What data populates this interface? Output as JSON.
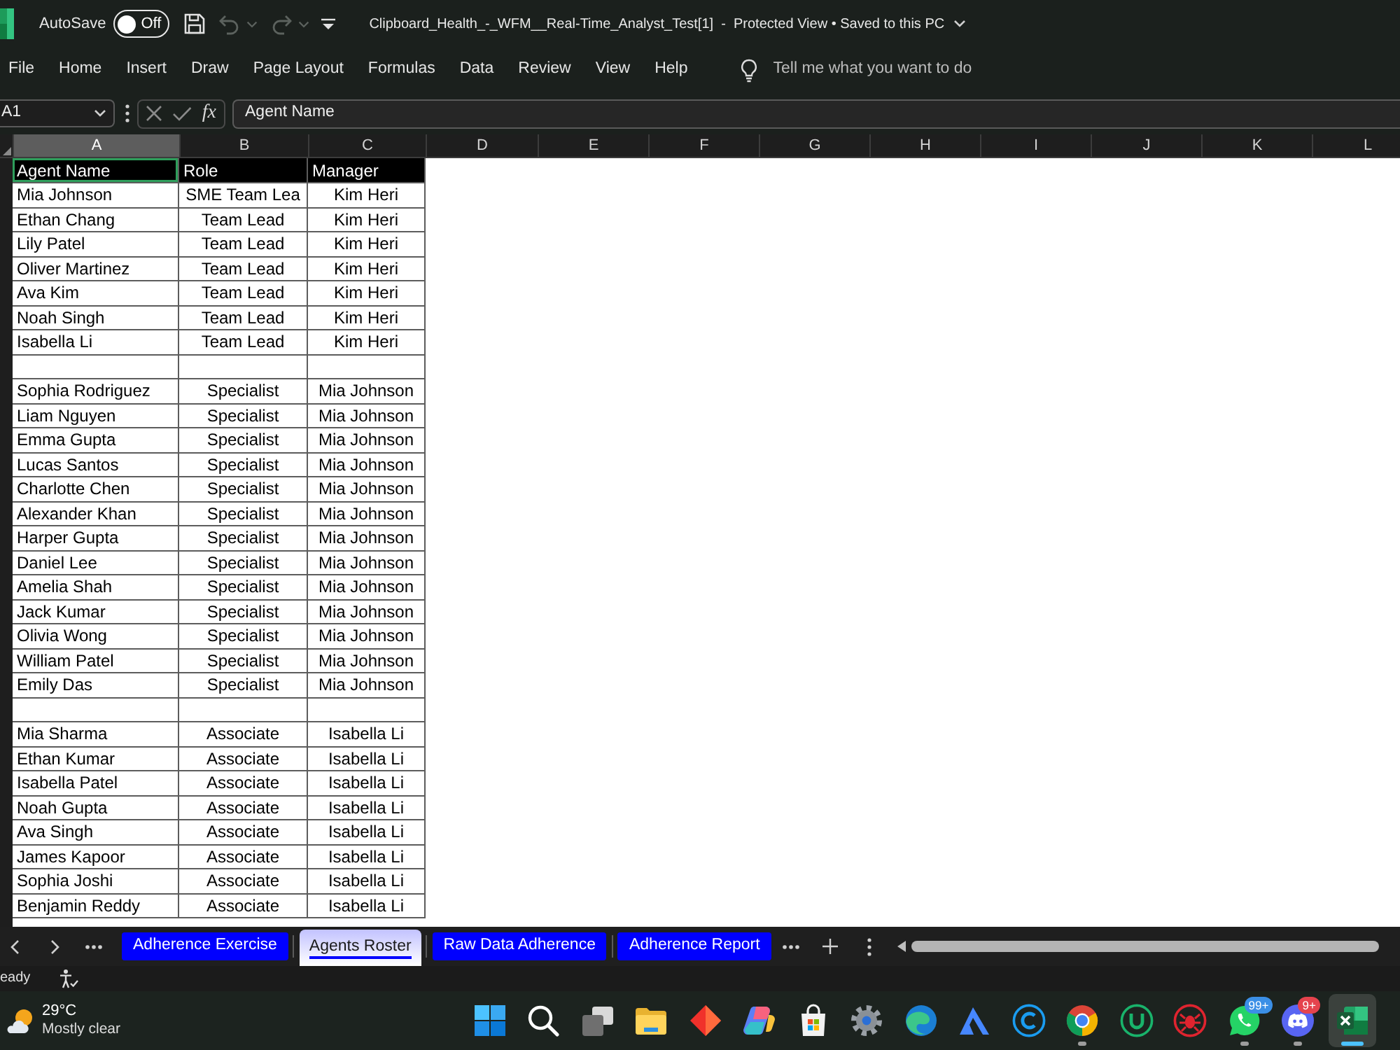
{
  "title_bar": {
    "autosave_label": "AutoSave",
    "autosave": {
      "on": false,
      "label": "Off"
    },
    "quick_access": [
      {
        "kind": "save",
        "disabled": false
      },
      {
        "kind": "undo",
        "disabled": true
      },
      {
        "kind": "redo",
        "disabled": true
      },
      {
        "kind": "customize",
        "disabled": false
      }
    ],
    "title": "Clipboard_Health_-_WFM__Real-Time_Analyst_Test[1]  -  Protected View • Saved to this PC"
  },
  "ribbon_tabs": [
    "File",
    "Home",
    "Insert",
    "Draw",
    "Page Layout",
    "Formulas",
    "Data",
    "Review",
    "View",
    "Help"
  ],
  "tell_me": {
    "placeholder": "Tell me what you want to do"
  },
  "formula_bar": {
    "name_box": "A1",
    "function_label": "fx",
    "value": "Agent Name"
  },
  "columns": [
    {
      "label": "A",
      "selected": true
    },
    {
      "label": "B",
      "selected": false
    },
    {
      "label": "C",
      "selected": false
    },
    {
      "label": "D",
      "selected": false
    },
    {
      "label": "E",
      "selected": false
    },
    {
      "label": "F",
      "selected": false
    },
    {
      "label": "G",
      "selected": false
    },
    {
      "label": "H",
      "selected": false
    },
    {
      "label": "I",
      "selected": false
    },
    {
      "label": "J",
      "selected": false
    },
    {
      "label": "K",
      "selected": false
    },
    {
      "label": "L",
      "selected": false
    }
  ],
  "sheet": {
    "header": [
      {
        "text": "Agent Name",
        "selected": true
      },
      {
        "text": "Role",
        "selected": false
      },
      {
        "text": "Manager",
        "selected": false
      }
    ],
    "rows": [
      {
        "kind": "data",
        "cells": [
          "Mia Johnson",
          "SME Team Lea",
          "Kim Heri"
        ]
      },
      {
        "kind": "data",
        "cells": [
          "Ethan Chang",
          "Team Lead",
          "Kim Heri"
        ]
      },
      {
        "kind": "data",
        "cells": [
          "Lily Patel",
          "Team Lead",
          "Kim Heri"
        ]
      },
      {
        "kind": "data",
        "cells": [
          "Oliver Martinez",
          "Team Lead",
          "Kim Heri"
        ]
      },
      {
        "kind": "data",
        "cells": [
          "Ava Kim",
          "Team Lead",
          "Kim Heri"
        ]
      },
      {
        "kind": "data",
        "cells": [
          "Noah Singh",
          "Team Lead",
          "Kim Heri"
        ]
      },
      {
        "kind": "data",
        "cells": [
          "Isabella Li",
          "Team Lead",
          "Kim Heri"
        ]
      },
      {
        "kind": "blank"
      },
      {
        "kind": "data",
        "cells": [
          "Sophia Rodriguez",
          "Specialist",
          "Mia Johnson"
        ]
      },
      {
        "kind": "data",
        "cells": [
          "Liam Nguyen",
          "Specialist",
          "Mia Johnson"
        ]
      },
      {
        "kind": "data",
        "cells": [
          "Emma Gupta",
          "Specialist",
          "Mia Johnson"
        ]
      },
      {
        "kind": "data",
        "cells": [
          "Lucas Santos",
          "Specialist",
          "Mia Johnson"
        ]
      },
      {
        "kind": "data",
        "cells": [
          "Charlotte Chen",
          "Specialist",
          "Mia Johnson"
        ]
      },
      {
        "kind": "data",
        "cells": [
          "Alexander Khan",
          "Specialist",
          "Mia Johnson"
        ]
      },
      {
        "kind": "data",
        "cells": [
          "Harper Gupta",
          "Specialist",
          "Mia Johnson"
        ]
      },
      {
        "kind": "data",
        "cells": [
          "Daniel Lee",
          "Specialist",
          "Mia Johnson"
        ]
      },
      {
        "kind": "data",
        "cells": [
          "Amelia Shah",
          "Specialist",
          "Mia Johnson"
        ]
      },
      {
        "kind": "data",
        "cells": [
          "Jack Kumar",
          "Specialist",
          "Mia Johnson"
        ]
      },
      {
        "kind": "data",
        "cells": [
          "Olivia Wong",
          "Specialist",
          "Mia Johnson"
        ]
      },
      {
        "kind": "data",
        "cells": [
          "William Patel",
          "Specialist",
          "Mia Johnson"
        ]
      },
      {
        "kind": "data",
        "cells": [
          "Emily Das",
          "Specialist",
          "Mia Johnson"
        ]
      },
      {
        "kind": "blank"
      },
      {
        "kind": "data",
        "cells": [
          "Mia Sharma",
          "Associate",
          "Isabella Li"
        ]
      },
      {
        "kind": "data",
        "cells": [
          "Ethan Kumar",
          "Associate",
          "Isabella Li"
        ]
      },
      {
        "kind": "data",
        "cells": [
          "Isabella Patel",
          "Associate",
          "Isabella Li"
        ]
      },
      {
        "kind": "data",
        "cells": [
          "Noah Gupta",
          "Associate",
          "Isabella Li"
        ]
      },
      {
        "kind": "data",
        "cells": [
          "Ava Singh",
          "Associate",
          "Isabella Li"
        ]
      },
      {
        "kind": "data",
        "cells": [
          "James Kapoor",
          "Associate",
          "Isabella Li"
        ]
      },
      {
        "kind": "data",
        "cells": [
          "Sophia Joshi",
          "Associate",
          "Isabella Li"
        ]
      },
      {
        "kind": "data",
        "cells": [
          "Benjamin Reddy",
          "Associate",
          "Isabella Li"
        ]
      }
    ]
  },
  "sheet_tabs": [
    {
      "label": "Adherence Exercise",
      "selected": false,
      "color": "#0000ff"
    },
    {
      "label": "Agents Roster",
      "selected": true,
      "color": "#0000ff"
    },
    {
      "label": "Raw Data Adherence",
      "selected": false,
      "color": "#0000ff"
    },
    {
      "label": "Adherence Report",
      "selected": false,
      "color": "#0000ff"
    }
  ],
  "status_bar": {
    "status": "eady"
  },
  "taskbar": {
    "weather": {
      "temperature": "29°C",
      "condition": "Mostly clear"
    },
    "apps": [
      {
        "kind": "grid",
        "running": false,
        "active": false
      },
      {
        "kind": "search",
        "running": false,
        "active": false
      },
      {
        "kind": "windows",
        "running": false,
        "active": false
      },
      {
        "kind": "folder",
        "running": false,
        "active": false
      },
      {
        "kind": "diamond",
        "running": false,
        "active": false
      },
      {
        "kind": "swirl",
        "running": false,
        "active": false
      },
      {
        "kind": "bag",
        "running": false,
        "active": false
      },
      {
        "kind": "gear",
        "running": false,
        "active": false
      },
      {
        "kind": "wave",
        "running": false,
        "active": false
      },
      {
        "kind": "mountain",
        "running": false,
        "active": false
      },
      {
        "kind": "arc",
        "running": false,
        "active": false
      },
      {
        "kind": "tricolor",
        "running": true,
        "active": false
      },
      {
        "kind": "cup",
        "running": false,
        "active": false
      },
      {
        "kind": "bug",
        "running": false,
        "active": false
      },
      {
        "kind": "bubble",
        "running": true,
        "active": false,
        "badge": {
          "text": "99+",
          "color": "#3b8fe6"
        }
      },
      {
        "kind": "gamepad",
        "running": true,
        "active": false,
        "badge": {
          "text": "9+",
          "color": "#e5434d"
        }
      },
      {
        "kind": "sheet",
        "running": true,
        "active": true
      }
    ]
  }
}
